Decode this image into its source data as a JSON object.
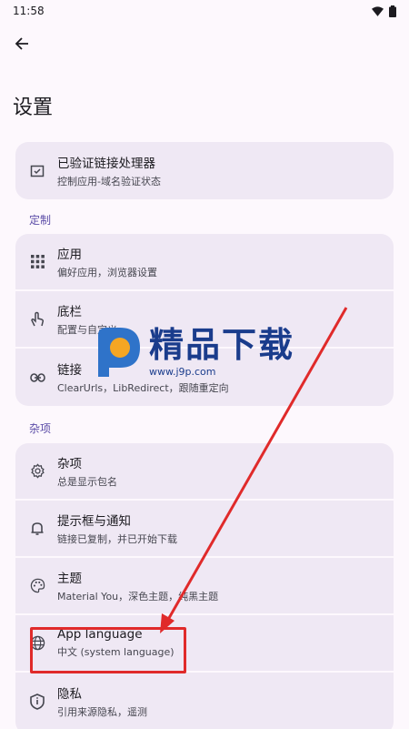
{
  "status_bar": {
    "time": "11:58"
  },
  "header": {
    "title": "设置"
  },
  "cards": {
    "verified_links": {
      "title": "已验证链接处理器",
      "subtitle": "控制应用-域名验证状态"
    }
  },
  "sections": {
    "customize": {
      "label": "定制",
      "items": [
        {
          "title": "应用",
          "subtitle": "偏好应用，浏览器设置",
          "icon": "grid-icon"
        },
        {
          "title": "底栏",
          "subtitle": "配置与自定义",
          "icon": "touch-icon"
        },
        {
          "title": "链接",
          "subtitle": "ClearUrls，LibRedirect，跟随重定向",
          "icon": "link-icon"
        }
      ]
    },
    "misc": {
      "label": "杂项",
      "items": [
        {
          "title": "杂项",
          "subtitle": "总是显示包名",
          "icon": "gear-icon"
        },
        {
          "title": "提示框与通知",
          "subtitle": "链接已复制，并已开始下载",
          "icon": "bell-icon"
        },
        {
          "title": "主题",
          "subtitle": "Material You，深色主题，纯黑主题",
          "icon": "palette-icon"
        },
        {
          "title": "App language",
          "subtitle": "中文 (system language)",
          "icon": "globe-icon"
        },
        {
          "title": "隐私",
          "subtitle": "引用来源隐私，遥测",
          "icon": "shield-icon"
        }
      ]
    }
  },
  "watermark": {
    "title": "精品下载",
    "url": "www.j9p.com"
  },
  "colors": {
    "accent": "#5b4ca7",
    "card_bg": "#efe8f4",
    "highlight": "#e02a2a"
  }
}
